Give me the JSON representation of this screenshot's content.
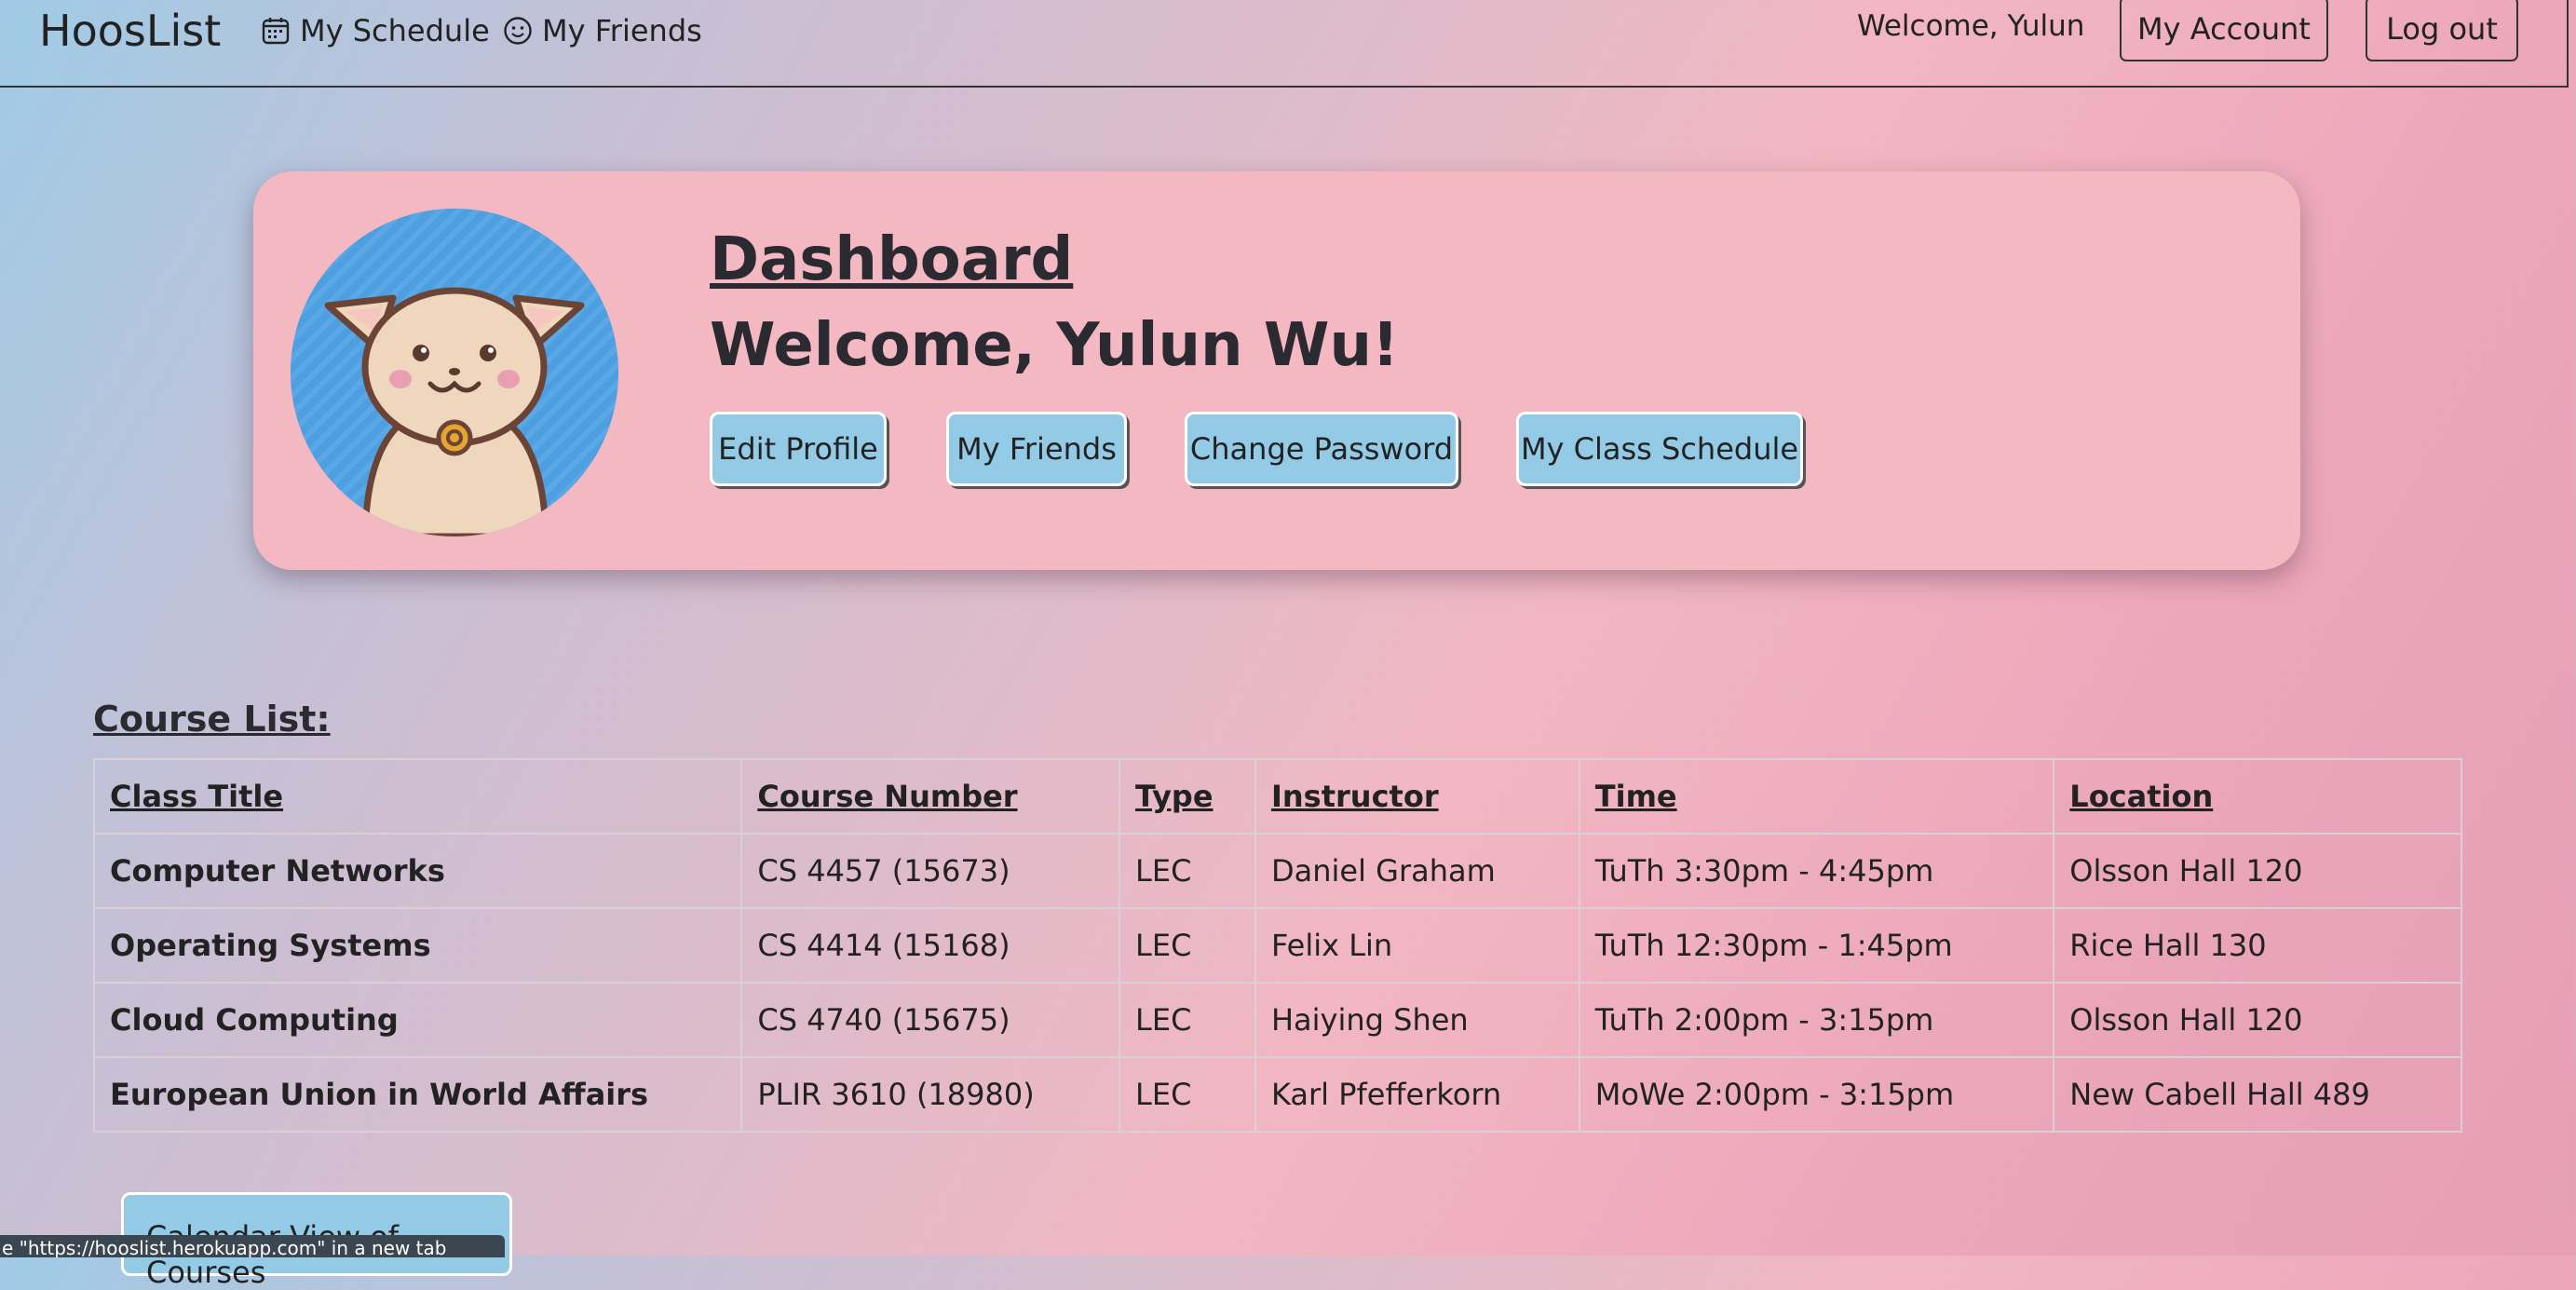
{
  "navbar": {
    "brand": "HoosList",
    "links": [
      {
        "label": "My Schedule",
        "icon": "calendar-icon"
      },
      {
        "label": "My Friends",
        "icon": "smiley-icon"
      }
    ],
    "welcome": "Welcome, Yulun",
    "my_account": "My Account",
    "logout": "Log out"
  },
  "dashboard": {
    "title": "Dashboard",
    "welcome": "Welcome, Yulun Wu!",
    "avatar_icon": "cat-avatar-icon",
    "buttons": {
      "edit_profile": "Edit Profile",
      "my_friends": "My Friends",
      "change_password": "Change Password",
      "class_schedule": "My Class Schedule"
    }
  },
  "course_list": {
    "heading": "Course List:",
    "columns": {
      "title": "Class Title",
      "number": "Course Number",
      "type": "Type",
      "instructor": "Instructor",
      "time": "Time",
      "location": "Location"
    },
    "rows": [
      {
        "title": "Computer Networks",
        "number": "CS 4457 (15673)",
        "type": "LEC",
        "instructor": "Daniel Graham",
        "time": "TuTh 3:30pm - 4:45pm",
        "location": "Olsson Hall 120"
      },
      {
        "title": "Operating Systems",
        "number": "CS 4414 (15168)",
        "type": "LEC",
        "instructor": "Felix Lin",
        "time": "TuTh 12:30pm - 1:45pm",
        "location": "Rice Hall 130"
      },
      {
        "title": "Cloud Computing",
        "number": "CS 4740 (15675)",
        "type": "LEC",
        "instructor": "Haiying Shen",
        "time": "TuTh 2:00pm - 3:15pm",
        "location": "Olsson Hall 120"
      },
      {
        "title": "European Union in World Affairs",
        "number": "PLIR 3610 (18980)",
        "type": "LEC",
        "instructor": "Karl Pfefferkorn",
        "time": "MoWe 2:00pm - 3:15pm",
        "location": "New Cabell Hall 489"
      }
    ],
    "calendar_button": "Calendar View of Courses"
  },
  "status_bar": "e \"https://hooslist.herokuapp.com\" in a new tab",
  "colors": {
    "button_blue": "#93cbe6",
    "card_pink": "#f4b8c2",
    "avatar_blue": "#4d9fe0"
  }
}
